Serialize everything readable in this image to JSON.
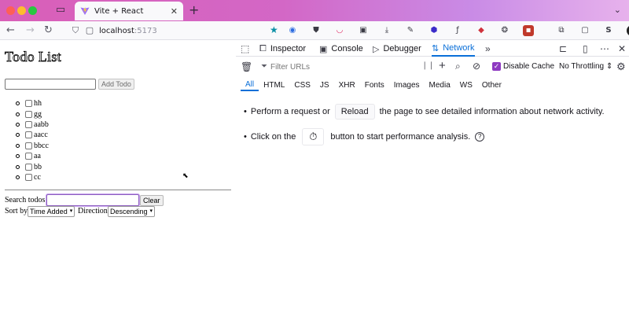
{
  "browser": {
    "tab": {
      "title": "Vite + React"
    },
    "url": {
      "host": "localhost",
      "port": ":5173"
    }
  },
  "app": {
    "title": "Todo List",
    "add_input": {
      "value": "",
      "placeholder": ""
    },
    "add_button": "Add Todo",
    "todos": [
      "hh",
      "gg",
      "aabb",
      "aacc",
      "bbcc",
      "aa",
      "bb",
      "cc"
    ],
    "search_label": "Search todos:",
    "search_value": "",
    "clear_button": "Clear",
    "sort_label": "Sort by",
    "sort_value": "Time Added",
    "direction_label": "Direction",
    "direction_value": "Descending"
  },
  "devtools": {
    "tabs": [
      {
        "label": "Inspector",
        "icon": "inspector-icon"
      },
      {
        "label": "Console",
        "icon": "console-icon"
      },
      {
        "label": "Debugger",
        "icon": "debugger-icon"
      },
      {
        "label": "Network",
        "icon": "network-icon",
        "active": true
      }
    ],
    "filter_placeholder": "Filter URLs",
    "disable_cache_label": "Disable Cache",
    "throttle_label": "No Throttling",
    "type_filters": [
      "All",
      "HTML",
      "CSS",
      "JS",
      "XHR",
      "Fonts",
      "Images",
      "Media",
      "WS",
      "Other"
    ],
    "info_line1": {
      "before": "Perform a request or",
      "button": "Reload",
      "after": "the page to see detailed information about network activity."
    },
    "info_line2": {
      "before": "Click on the",
      "after": "button to start performance analysis."
    }
  },
  "colors": {
    "accent": "#0a6fd8",
    "checkbox": "#8e3ac1"
  }
}
